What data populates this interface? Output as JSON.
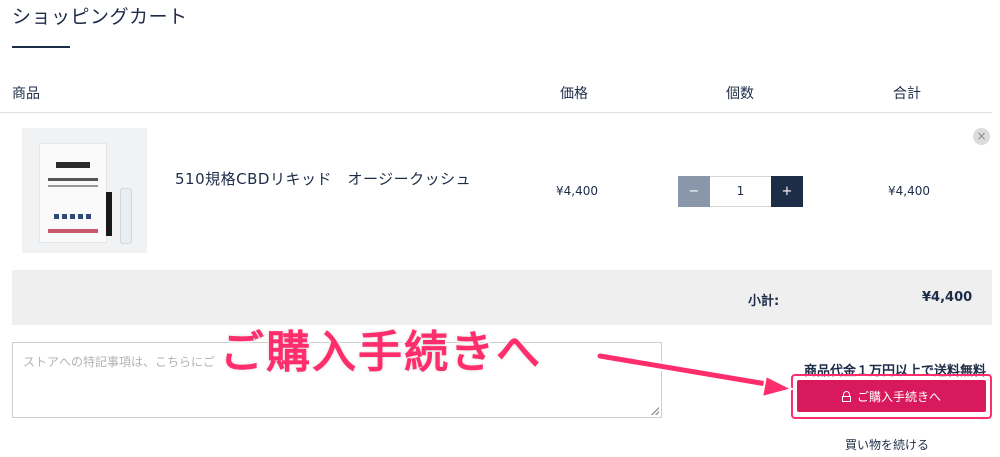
{
  "page": {
    "title": "ショッピングカート"
  },
  "table": {
    "headers": {
      "product": "商品",
      "price": "価格",
      "quantity": "個数",
      "total": "合計"
    }
  },
  "item": {
    "name": "510規格CBDリキッド　オージークッシュ",
    "price": "¥4,400",
    "quantity": "1",
    "line_total": "¥4,400",
    "image_lettering": "CHILLAXY"
  },
  "controls": {
    "remove": "×",
    "minus": "−",
    "plus": "+"
  },
  "summary": {
    "subtotal_label": "小計:",
    "subtotal_value": "¥4,400"
  },
  "notes": {
    "placeholder": "ストアへの特記事項は、こちらにご"
  },
  "checkout": {
    "free_shipping": "商品代金１万円以上で送料無料",
    "button_label": "ご購入手続きへ",
    "continue_label": "買い物を続ける"
  },
  "annotation": {
    "text": "ご購入手続きへ",
    "color": "#ff2d6c"
  },
  "colors": {
    "navy": "#1d2c47",
    "checkout": "#d81a5c",
    "minus_btn": "#8a97aa"
  },
  "icons": {
    "lock": "lock-icon",
    "remove": "close-icon"
  }
}
